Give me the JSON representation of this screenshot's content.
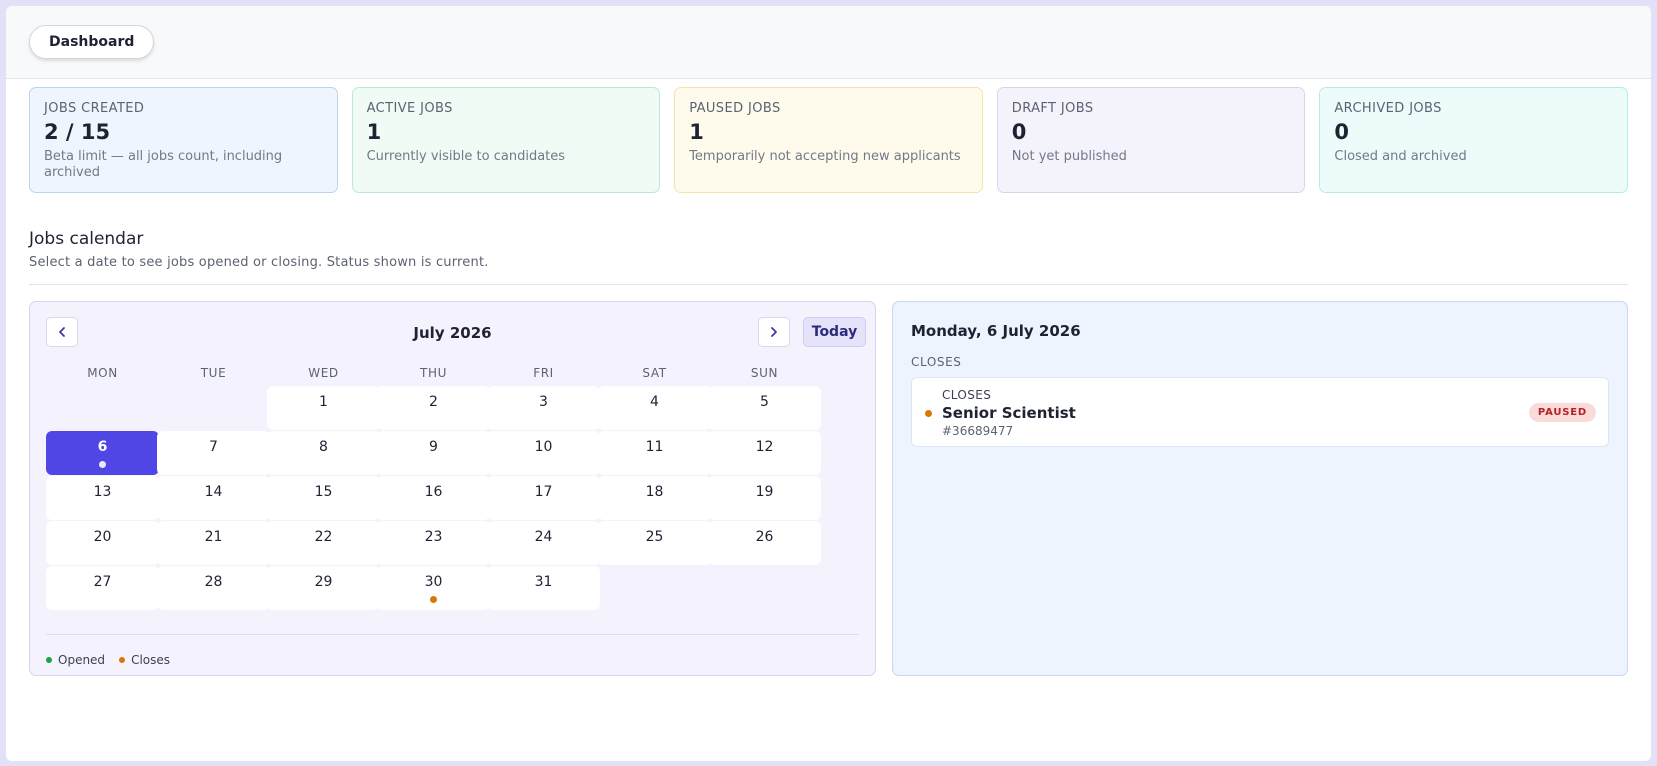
{
  "colors": {
    "accent": "#4f46e5",
    "opened": "#16a34a",
    "closes": "#d97706",
    "paused_badge_bg": "#fbdada",
    "paused_badge_text": "#b42323"
  },
  "header": {
    "dashboard_label": "Dashboard"
  },
  "stats": [
    {
      "label": "JOBS CREATED",
      "value": "2 / 15",
      "description": "Beta limit — all jobs count, including archived"
    },
    {
      "label": "ACTIVE JOBS",
      "value": "1",
      "description": "Currently visible to candidates"
    },
    {
      "label": "PAUSED JOBS",
      "value": "1",
      "description": "Temporarily not accepting new applicants"
    },
    {
      "label": "DRAFT JOBS",
      "value": "0",
      "description": "Not yet published"
    },
    {
      "label": "ARCHIVED JOBS",
      "value": "0",
      "description": "Closed and archived"
    }
  ],
  "calendar_section": {
    "title": "Jobs calendar",
    "subtitle": "Select a date to see jobs opened or closing. Status shown is current."
  },
  "calendar": {
    "month_label": "July 2026",
    "today_label": "Today",
    "prev_icon": "chevron-left-icon",
    "next_icon": "chevron-right-icon",
    "weekdays": [
      "MON",
      "TUE",
      "WED",
      "THU",
      "FRI",
      "SAT",
      "SUN"
    ],
    "first_weekday_index": 2,
    "days_in_month": 31,
    "selected_day": 6,
    "markers": {
      "6": "selected",
      "30": "closes"
    },
    "legend": {
      "opened": "Opened",
      "closes": "Closes"
    }
  },
  "detail": {
    "date_heading": "Monday, 6 July 2026",
    "group_label": "CLOSES",
    "jobs": [
      {
        "kind": "CLOSES",
        "title": "Senior Scientist",
        "id": "#36689477",
        "status": "PAUSED"
      }
    ]
  }
}
